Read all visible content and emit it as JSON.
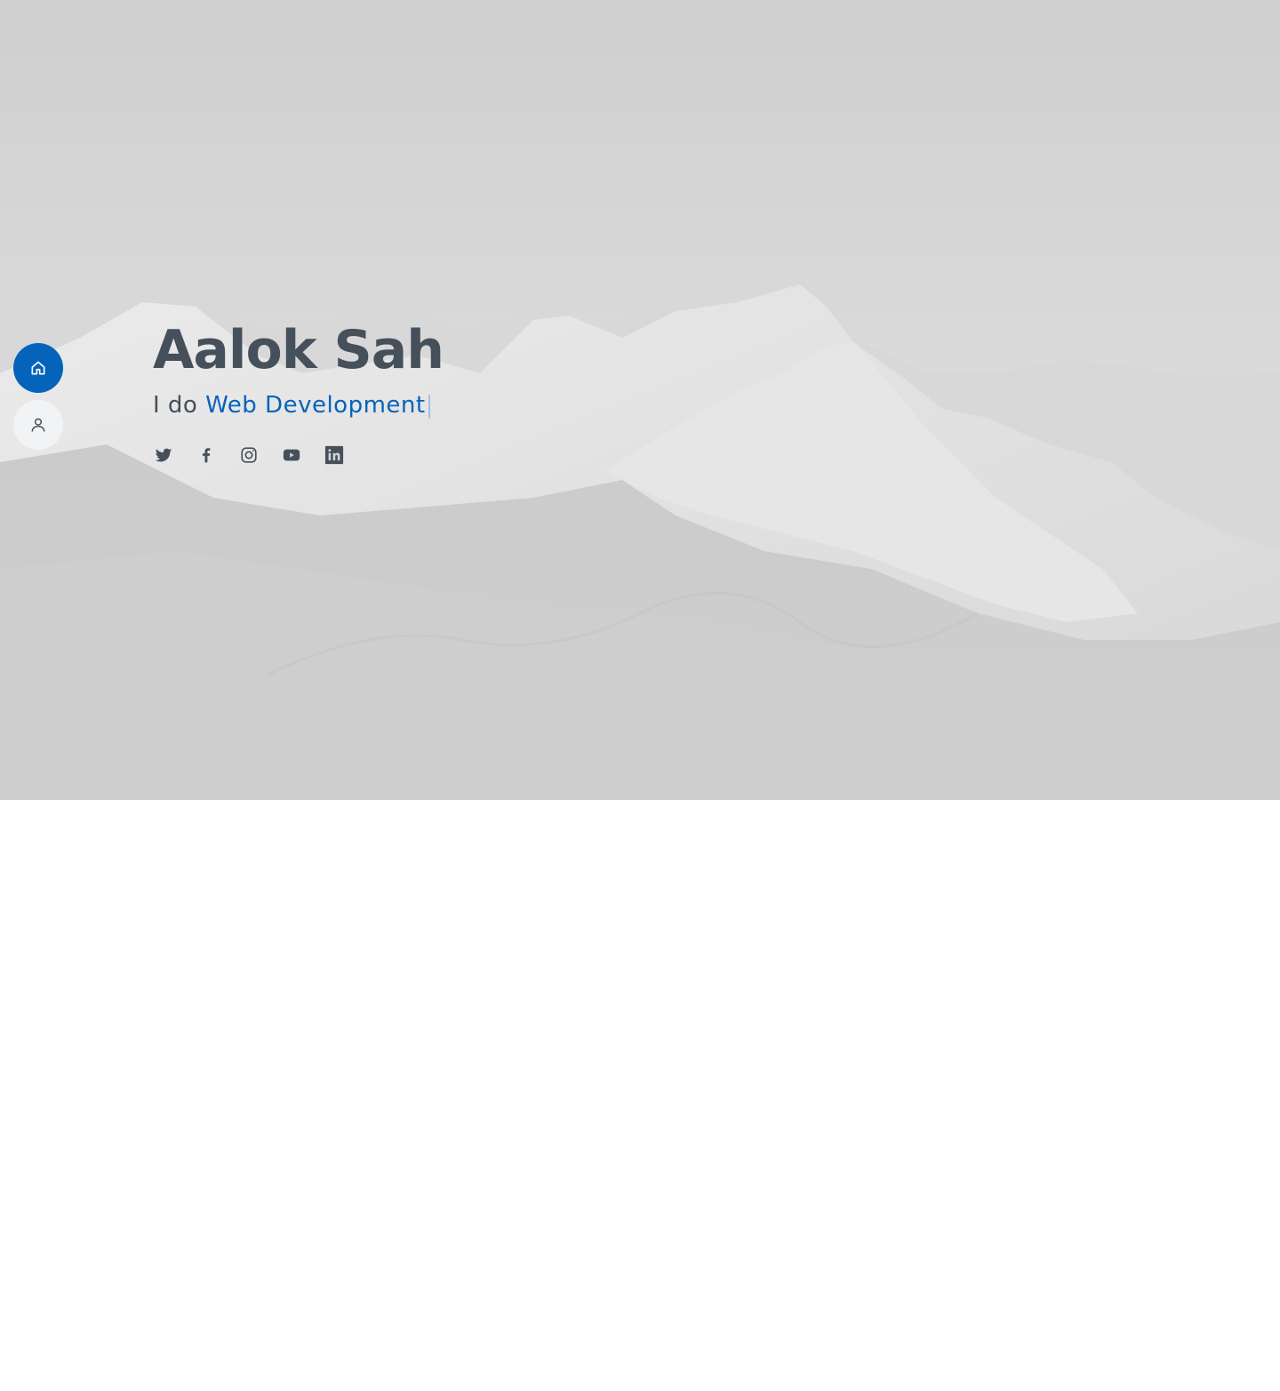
{
  "hero": {
    "name": "Aalok Sah",
    "tagline_prefix": "I do",
    "tagline_highlight": "Web Development",
    "tagline_cursor": "|"
  },
  "nav": {
    "items": [
      {
        "icon": "home-icon",
        "active": true
      },
      {
        "icon": "person-icon",
        "active": false
      }
    ]
  },
  "social": [
    {
      "icon": "twitter-icon"
    },
    {
      "icon": "facebook-icon"
    },
    {
      "icon": "instagram-icon"
    },
    {
      "icon": "youtube-icon"
    },
    {
      "icon": "linkedin-icon"
    }
  ],
  "colors": {
    "accent": "#0563bb",
    "text": "#45505b",
    "nav_inactive": "#f2f3f5"
  }
}
